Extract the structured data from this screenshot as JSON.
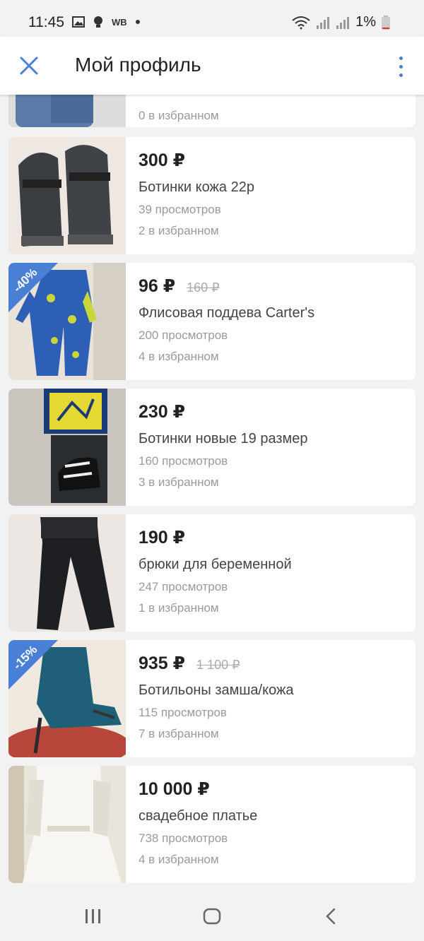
{
  "status": {
    "time": "11:45",
    "carrier_badge": "WB",
    "battery": "1%"
  },
  "appbar": {
    "title": "Мой профиль",
    "close_icon": "close-icon",
    "more_icon": "more-vert-icon"
  },
  "listings": [
    {
      "price": "",
      "old_price": "",
      "title": "",
      "views": "",
      "favorites": "0 в избранном",
      "discount": ""
    },
    {
      "price": "300 ₽",
      "old_price": "",
      "title": "Ботинки кожа 22р",
      "views": "39 просмотров",
      "favorites": "2 в избранном",
      "discount": ""
    },
    {
      "price": "96 ₽",
      "old_price": "160 ₽",
      "title": "Флисовая поддева Carter's",
      "views": "200 просмотров",
      "favorites": "4 в избранном",
      "discount": "-40%"
    },
    {
      "price": "230 ₽",
      "old_price": "",
      "title": "Ботинки новые 19 размер",
      "views": "160 просмотров",
      "favorites": "3 в избранном",
      "discount": ""
    },
    {
      "price": "190 ₽",
      "old_price": "",
      "title": "брюки для беременной",
      "views": "247 просмотров",
      "favorites": "1 в избранном",
      "discount": ""
    },
    {
      "price": "935 ₽",
      "old_price": "1 100 ₽",
      "title": "Ботильоны замша/кожа",
      "views": "115 просмотров",
      "favorites": "7 в избранном",
      "discount": "-15%"
    },
    {
      "price": "10 000 ₽",
      "old_price": "",
      "title": "свадебное платье",
      "views": "738 просмотров",
      "favorites": "4 в избранном",
      "discount": ""
    }
  ],
  "navbar": {
    "recents_icon": "recents-icon",
    "home_icon": "home-icon",
    "back_icon": "back-icon"
  },
  "colors": {
    "accent": "#4a7fd6",
    "background": "#f2f2f2",
    "card": "#ffffff"
  }
}
